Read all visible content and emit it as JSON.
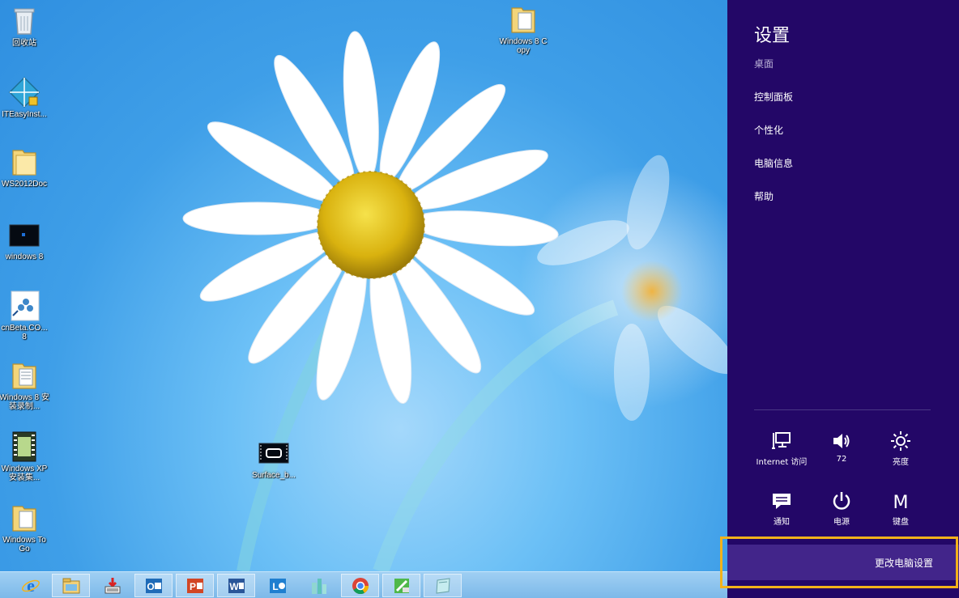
{
  "desktop": {
    "icons": [
      {
        "label": "回收站",
        "icon": "recycle-bin-icon"
      },
      {
        "label": "ITEasyInst...",
        "icon": "installer-shortcut-icon"
      },
      {
        "label": "WS2012Doc",
        "icon": "folder-icon"
      },
      {
        "label": "windows 8",
        "icon": "video-file-icon"
      },
      {
        "label": "cnBeta.CO... 8",
        "icon": "web-shortcut-icon"
      },
      {
        "label": "Windows 8 安装录制...",
        "icon": "folder-icon"
      },
      {
        "label": "Windows XP安装集...",
        "icon": "film-file-icon"
      },
      {
        "label": "Windows To Go",
        "icon": "folder-icon"
      },
      {
        "label": "Windows 8 Copy",
        "icon": "folder-icon"
      },
      {
        "label": "Surface_b...",
        "icon": "video-file-icon"
      }
    ]
  },
  "taskbar": {
    "items": [
      {
        "name": "internet-explorer",
        "icon": "ie-icon"
      },
      {
        "name": "file-explorer",
        "icon": "file-explorer-icon"
      },
      {
        "name": "downloader",
        "icon": "download-icon"
      },
      {
        "name": "outlook",
        "icon": "outlook-icon"
      },
      {
        "name": "powerpoint",
        "icon": "powerpoint-icon"
      },
      {
        "name": "word",
        "icon": "word-icon"
      },
      {
        "name": "lync",
        "icon": "lync-icon"
      },
      {
        "name": "city-app",
        "icon": "buildings-icon"
      },
      {
        "name": "chrome",
        "icon": "chrome-icon"
      },
      {
        "name": "paint-tool",
        "icon": "paint-icon"
      },
      {
        "name": "app-window",
        "icon": "app-window-icon"
      }
    ]
  },
  "charm": {
    "title": "设置",
    "context": "桌面",
    "links": [
      "控制面板",
      "个性化",
      "电脑信息",
      "帮助"
    ],
    "quick_settings": [
      {
        "label": "Internet 访问",
        "icon": "network-icon"
      },
      {
        "label": "72",
        "icon": "volume-icon"
      },
      {
        "label": "亮度",
        "icon": "brightness-icon"
      },
      {
        "label": "通知",
        "icon": "notifications-icon"
      },
      {
        "label": "电源",
        "icon": "power-icon"
      },
      {
        "label": "键盘",
        "icon": "keyboard-icon",
        "glyph": "M"
      }
    ],
    "change_pc_settings": "更改电脑设置"
  },
  "colors": {
    "charm_bg": "#230767",
    "charm_button_bg": "#42258a",
    "highlight": "#f3b21a",
    "desktop_sky": "#3aa0ea"
  }
}
